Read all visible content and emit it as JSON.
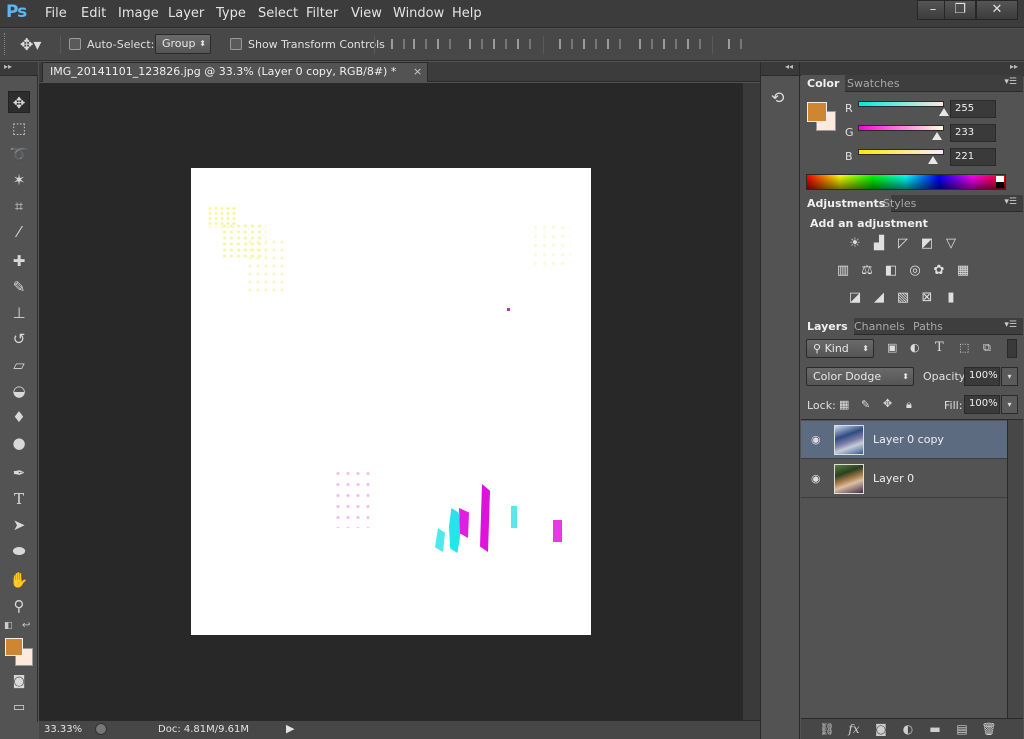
{
  "app": {
    "logo": "Ps"
  },
  "menu": [
    "File",
    "Edit",
    "Image",
    "Layer",
    "Type",
    "Select",
    "Filter",
    "View",
    "Window",
    "Help"
  ],
  "window_controls": {
    "minimize": "–",
    "restore": "❐",
    "close": "✕"
  },
  "options": {
    "auto_select_label": "Auto-Select:",
    "auto_select_checked": false,
    "auto_select_value": "Group",
    "show_transform_label": "Show Transform Controls",
    "show_transform_checked": false
  },
  "document": {
    "tab_title": "IMG_20141101_123826.jpg @ 33.3% (Layer 0 copy, RGB/8#) *",
    "close": "×"
  },
  "status": {
    "zoom": "33.33%",
    "doc": "Doc: 4.81M/9.61M"
  },
  "colors": {
    "foreground": "#d08630",
    "background": "#ffe9dd",
    "accent": "#5db7f2",
    "selection": "#5c6b80"
  },
  "color_panel": {
    "tabs": [
      "Color",
      "Swatches"
    ],
    "active_tab": "Color",
    "channels": [
      {
        "label": "R",
        "value": "255",
        "level": 1.0,
        "gradient": "linear-gradient(to right,#00e9dd,#ffe9dd)"
      },
      {
        "label": "G",
        "value": "233",
        "level": 0.914,
        "gradient": "linear-gradient(to right,#ff00dd,#ffffdd)"
      },
      {
        "label": "B",
        "value": "221",
        "level": 0.867,
        "gradient": "linear-gradient(to right,#ffe900,#ffe9ff)"
      }
    ]
  },
  "adjustments_panel": {
    "tabs": [
      "Adjustments",
      "Styles"
    ],
    "active_tab": "Adjustments",
    "heading": "Add an adjustment",
    "icons": [
      [
        "brightness-contrast-icon",
        "levels-icon",
        "curves-icon",
        "exposure-icon",
        "vibrance-icon"
      ],
      [
        "hue-saturation-icon",
        "color-balance-icon",
        "black-white-icon",
        "photo-filter-icon",
        "channel-mixer-icon",
        "color-lookup-icon"
      ],
      [
        "invert-icon",
        "posterize-icon",
        "threshold-icon",
        "selective-color-icon",
        "gradient-map-icon"
      ]
    ]
  },
  "layers_panel": {
    "tabs": [
      "Layers",
      "Channels",
      "Paths"
    ],
    "active_tab": "Layers",
    "filter_kind": "Kind",
    "blend_mode": "Color Dodge",
    "opacity_label": "Opacity:",
    "opacity_value": "100%",
    "lock_label": "Lock:",
    "fill_label": "Fill:",
    "fill_value": "100%",
    "layers": [
      {
        "name": "Layer 0 copy",
        "visible": true,
        "selected": true
      },
      {
        "name": "Layer 0",
        "visible": true,
        "selected": false
      }
    ]
  }
}
